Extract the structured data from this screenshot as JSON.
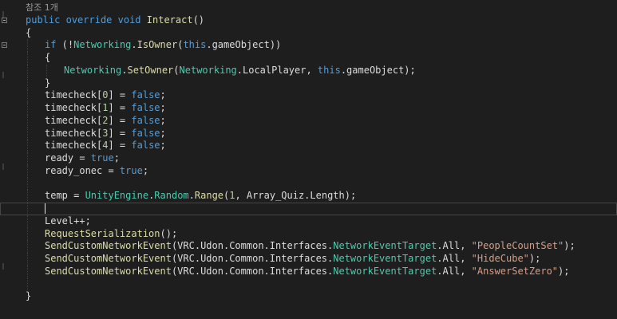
{
  "editor": {
    "codelens": "참조 1개",
    "lines": [
      {
        "indent": 0,
        "tokens": [
          [
            "kw",
            "public"
          ],
          [
            "plain",
            " "
          ],
          [
            "kw",
            "override"
          ],
          [
            "plain",
            " "
          ],
          [
            "kw",
            "void"
          ],
          [
            "plain",
            " "
          ],
          [
            "method",
            "Interact"
          ],
          [
            "plain",
            "()"
          ]
        ]
      },
      {
        "indent": 0,
        "tokens": [
          [
            "plain",
            "{"
          ]
        ]
      },
      {
        "indent": 1,
        "tokens": [
          [
            "kw",
            "if"
          ],
          [
            "plain",
            " (!"
          ],
          [
            "type",
            "Networking"
          ],
          [
            "plain",
            "."
          ],
          [
            "method",
            "IsOwner"
          ],
          [
            "plain",
            "("
          ],
          [
            "kw",
            "this"
          ],
          [
            "plain",
            ".gameObject))"
          ]
        ]
      },
      {
        "indent": 1,
        "tokens": [
          [
            "plain",
            "{"
          ]
        ]
      },
      {
        "indent": 2,
        "tokens": [
          [
            "type",
            "Networking"
          ],
          [
            "plain",
            "."
          ],
          [
            "method",
            "SetOwner"
          ],
          [
            "plain",
            "("
          ],
          [
            "type",
            "Networking"
          ],
          [
            "plain",
            ".LocalPlayer, "
          ],
          [
            "kw",
            "this"
          ],
          [
            "plain",
            ".gameObject);"
          ]
        ]
      },
      {
        "indent": 1,
        "tokens": [
          [
            "plain",
            "}"
          ]
        ]
      },
      {
        "indent": 1,
        "tokens": [
          [
            "plain",
            "timecheck["
          ],
          [
            "num",
            "0"
          ],
          [
            "plain",
            "] = "
          ],
          [
            "kw",
            "false"
          ],
          [
            "plain",
            ";"
          ]
        ]
      },
      {
        "indent": 1,
        "tokens": [
          [
            "plain",
            "timecheck["
          ],
          [
            "num",
            "1"
          ],
          [
            "plain",
            "] = "
          ],
          [
            "kw",
            "false"
          ],
          [
            "plain",
            ";"
          ]
        ]
      },
      {
        "indent": 1,
        "tokens": [
          [
            "plain",
            "timecheck["
          ],
          [
            "num",
            "2"
          ],
          [
            "plain",
            "] = "
          ],
          [
            "kw",
            "false"
          ],
          [
            "plain",
            ";"
          ]
        ]
      },
      {
        "indent": 1,
        "tokens": [
          [
            "plain",
            "timecheck["
          ],
          [
            "num",
            "3"
          ],
          [
            "plain",
            "] = "
          ],
          [
            "kw",
            "false"
          ],
          [
            "plain",
            ";"
          ]
        ]
      },
      {
        "indent": 1,
        "tokens": [
          [
            "plain",
            "timecheck["
          ],
          [
            "num",
            "4"
          ],
          [
            "plain",
            "] = "
          ],
          [
            "kw",
            "false"
          ],
          [
            "plain",
            ";"
          ]
        ]
      },
      {
        "indent": 1,
        "tokens": [
          [
            "plain",
            "ready = "
          ],
          [
            "kw",
            "true"
          ],
          [
            "plain",
            ";"
          ]
        ]
      },
      {
        "indent": 1,
        "tokens": [
          [
            "plain",
            "ready_onec = "
          ],
          [
            "kw",
            "true"
          ],
          [
            "plain",
            ";"
          ]
        ]
      },
      {
        "indent": 1,
        "tokens": []
      },
      {
        "indent": 1,
        "tokens": [
          [
            "plain",
            "temp = "
          ],
          [
            "type",
            "UnityEngine"
          ],
          [
            "plain",
            "."
          ],
          [
            "type",
            "Random"
          ],
          [
            "plain",
            "."
          ],
          [
            "method",
            "Range"
          ],
          [
            "plain",
            "("
          ],
          [
            "num",
            "1"
          ],
          [
            "plain",
            ", Array_Quiz.Length);"
          ]
        ]
      },
      {
        "indent": 1,
        "tokens": [],
        "current": true
      },
      {
        "indent": 1,
        "tokens": [
          [
            "plain",
            "Level++;"
          ]
        ]
      },
      {
        "indent": 1,
        "tokens": [
          [
            "method",
            "RequestSerialization"
          ],
          [
            "plain",
            "();"
          ]
        ]
      },
      {
        "indent": 1,
        "tokens": [
          [
            "method",
            "SendCustomNetworkEvent"
          ],
          [
            "plain",
            "(VRC.Udon.Common.Interfaces."
          ],
          [
            "type",
            "NetworkEventTarget"
          ],
          [
            "plain",
            ".All, "
          ],
          [
            "str",
            "\"PeopleCountSet\""
          ],
          [
            "plain",
            ");"
          ]
        ]
      },
      {
        "indent": 1,
        "tokens": [
          [
            "method",
            "SendCustomNetworkEvent"
          ],
          [
            "plain",
            "(VRC.Udon.Common.Interfaces."
          ],
          [
            "type",
            "NetworkEventTarget"
          ],
          [
            "plain",
            ".All, "
          ],
          [
            "str",
            "\"HideCube\""
          ],
          [
            "plain",
            ");"
          ]
        ]
      },
      {
        "indent": 1,
        "tokens": [
          [
            "method",
            "SendCustomNetworkEvent"
          ],
          [
            "plain",
            "(VRC.Udon.Common.Interfaces."
          ],
          [
            "type",
            "NetworkEventTarget"
          ],
          [
            "plain",
            ".All, "
          ],
          [
            "str",
            "\"AnswerSetZero\""
          ],
          [
            "plain",
            ");"
          ]
        ]
      },
      {
        "indent": 1,
        "tokens": []
      },
      {
        "indent": 0,
        "tokens": [
          [
            "plain",
            "}"
          ]
        ]
      }
    ]
  }
}
